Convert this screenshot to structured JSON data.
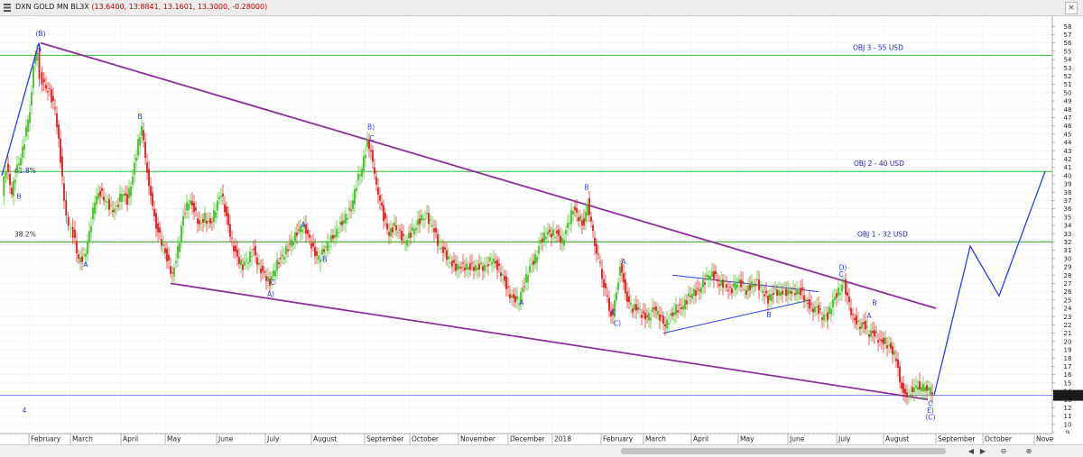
{
  "window": {
    "title": "DXN GOLD MN BL3X",
    "quote": "(13.6400, 13.8841, 13.1601, 13.3000, -0.28000)",
    "close_glyph": "×"
  },
  "scroll_buttons": [
    "◀",
    "▶",
    "⊖",
    "⊕"
  ],
  "colors": {
    "bull": "#44c026",
    "bear": "#dd1f1f",
    "trend": "#8b2e9a",
    "wave": "#2b3de0",
    "target": "#2fc12f",
    "fib": "#e05a8a",
    "current_price": "#8080ff"
  },
  "chart_data": {
    "type": "candlestick",
    "ylim": [
      9,
      59
    ],
    "xlim": [
      0,
      1145
    ],
    "y_ticks": [
      9,
      10,
      11,
      12,
      13,
      14,
      15,
      16,
      17,
      18,
      19,
      20,
      21,
      22,
      23,
      24,
      25,
      26,
      27,
      28,
      29,
      30,
      31,
      32,
      33,
      34,
      35,
      36,
      37,
      38,
      39,
      40,
      41,
      42,
      43,
      44,
      45,
      46,
      47,
      48,
      49,
      50,
      51,
      52,
      53,
      54,
      55,
      56,
      57,
      58
    ],
    "x_ticks": [
      {
        "label": "February",
        "x": 32
      },
      {
        "label": "March",
        "x": 78
      },
      {
        "label": "April",
        "x": 134
      },
      {
        "label": "May",
        "x": 183
      },
      {
        "label": "June",
        "x": 240
      },
      {
        "label": "July",
        "x": 294
      },
      {
        "label": "August",
        "x": 345
      },
      {
        "label": "September",
        "x": 404
      },
      {
        "label": "October",
        "x": 454
      },
      {
        "label": "November",
        "x": 508
      },
      {
        "label": "December",
        "x": 563
      },
      {
        "label": "2018",
        "x": 612
      },
      {
        "label": "February",
        "x": 666
      },
      {
        "label": "March",
        "x": 713
      },
      {
        "label": "April",
        "x": 766
      },
      {
        "label": "May",
        "x": 818
      },
      {
        "label": "June",
        "x": 873
      },
      {
        "label": "July",
        "x": 927
      },
      {
        "label": "August",
        "x": 979
      },
      {
        "label": "September",
        "x": 1037
      },
      {
        "label": "October",
        "x": 1089
      },
      {
        "label": "Nove",
        "x": 1146
      }
    ],
    "price_path": [
      [
        3,
        38
      ],
      [
        8,
        41
      ],
      [
        14,
        38
      ],
      [
        20,
        41
      ],
      [
        26,
        43
      ],
      [
        34,
        48
      ],
      [
        38,
        53
      ],
      [
        42,
        55
      ],
      [
        45,
        52
      ],
      [
        50,
        51
      ],
      [
        56,
        50
      ],
      [
        62,
        48
      ],
      [
        68,
        42
      ],
      [
        72,
        37
      ],
      [
        77,
        34
      ],
      [
        82,
        33
      ],
      [
        88,
        30
      ],
      [
        94,
        30
      ],
      [
        100,
        33
      ],
      [
        106,
        37
      ],
      [
        112,
        38
      ],
      [
        118,
        37
      ],
      [
        124,
        36
      ],
      [
        130,
        36
      ],
      [
        136,
        38
      ],
      [
        142,
        37
      ],
      [
        148,
        40
      ],
      [
        154,
        44
      ],
      [
        158,
        46
      ],
      [
        162,
        42
      ],
      [
        166,
        39
      ],
      [
        170,
        36
      ],
      [
        174,
        34
      ],
      [
        180,
        32
      ],
      [
        186,
        30
      ],
      [
        192,
        28
      ],
      [
        198,
        31
      ],
      [
        204,
        35
      ],
      [
        210,
        37
      ],
      [
        216,
        36
      ],
      [
        222,
        34
      ],
      [
        228,
        35
      ],
      [
        234,
        34
      ],
      [
        240,
        36
      ],
      [
        246,
        38
      ],
      [
        252,
        35
      ],
      [
        258,
        32
      ],
      [
        264,
        30
      ],
      [
        270,
        29
      ],
      [
        276,
        30
      ],
      [
        282,
        31
      ],
      [
        288,
        29
      ],
      [
        294,
        28
      ],
      [
        300,
        27
      ],
      [
        306,
        29
      ],
      [
        312,
        30
      ],
      [
        318,
        31
      ],
      [
        324,
        32
      ],
      [
        330,
        33
      ],
      [
        336,
        34
      ],
      [
        342,
        33
      ],
      [
        348,
        31
      ],
      [
        354,
        30
      ],
      [
        360,
        31
      ],
      [
        366,
        32
      ],
      [
        372,
        33
      ],
      [
        378,
        34
      ],
      [
        384,
        35
      ],
      [
        390,
        36
      ],
      [
        396,
        39
      ],
      [
        402,
        41
      ],
      [
        408,
        44
      ],
      [
        412,
        43
      ],
      [
        416,
        40
      ],
      [
        420,
        38
      ],
      [
        426,
        35
      ],
      [
        432,
        33
      ],
      [
        438,
        34
      ],
      [
        444,
        33
      ],
      [
        450,
        32
      ],
      [
        456,
        33
      ],
      [
        462,
        34
      ],
      [
        468,
        35
      ],
      [
        474,
        35
      ],
      [
        480,
        34
      ],
      [
        486,
        32
      ],
      [
        492,
        31
      ],
      [
        498,
        30
      ],
      [
        504,
        29
      ],
      [
        510,
        29
      ],
      [
        516,
        29
      ],
      [
        522,
        29
      ],
      [
        528,
        29
      ],
      [
        534,
        29
      ],
      [
        540,
        29
      ],
      [
        546,
        30
      ],
      [
        552,
        29
      ],
      [
        558,
        28
      ],
      [
        564,
        26
      ],
      [
        570,
        25
      ],
      [
        576,
        25
      ],
      [
        582,
        27
      ],
      [
        588,
        29
      ],
      [
        594,
        30
      ],
      [
        600,
        32
      ],
      [
        606,
        33
      ],
      [
        612,
        33
      ],
      [
        618,
        33
      ],
      [
        624,
        32
      ],
      [
        630,
        34
      ],
      [
        636,
        36
      ],
      [
        642,
        35
      ],
      [
        648,
        34
      ],
      [
        652,
        37
      ],
      [
        656,
        34
      ],
      [
        660,
        32
      ],
      [
        664,
        30
      ],
      [
        668,
        28
      ],
      [
        672,
        26
      ],
      [
        676,
        24
      ],
      [
        680,
        23
      ],
      [
        684,
        26
      ],
      [
        688,
        29
      ],
      [
        692,
        27
      ],
      [
        696,
        25
      ],
      [
        702,
        24
      ],
      [
        708,
        24
      ],
      [
        714,
        23
      ],
      [
        720,
        23
      ],
      [
        726,
        24
      ],
      [
        732,
        23
      ],
      [
        738,
        22
      ],
      [
        744,
        23
      ],
      [
        750,
        24
      ],
      [
        756,
        24
      ],
      [
        762,
        25
      ],
      [
        768,
        26
      ],
      [
        774,
        26
      ],
      [
        780,
        27
      ],
      [
        786,
        28
      ],
      [
        792,
        28
      ],
      [
        798,
        27
      ],
      [
        804,
        27
      ],
      [
        810,
        26
      ],
      [
        816,
        27
      ],
      [
        822,
        27
      ],
      [
        828,
        26
      ],
      [
        834,
        27
      ],
      [
        840,
        27
      ],
      [
        846,
        26
      ],
      [
        852,
        25
      ],
      [
        858,
        26
      ],
      [
        864,
        26
      ],
      [
        870,
        26
      ],
      [
        876,
        26
      ],
      [
        882,
        26
      ],
      [
        888,
        26
      ],
      [
        894,
        25
      ],
      [
        900,
        24
      ],
      [
        906,
        24
      ],
      [
        912,
        23
      ],
      [
        918,
        23
      ],
      [
        924,
        25
      ],
      [
        930,
        26
      ],
      [
        936,
        27
      ],
      [
        940,
        25
      ],
      [
        946,
        23
      ],
      [
        952,
        22
      ],
      [
        958,
        22
      ],
      [
        964,
        21
      ],
      [
        970,
        21
      ],
      [
        976,
        20
      ],
      [
        982,
        20
      ],
      [
        988,
        19
      ],
      [
        994,
        18
      ],
      [
        998,
        15
      ],
      [
        1002,
        14
      ],
      [
        1006,
        13
      ],
      [
        1010,
        14
      ],
      [
        1014,
        14
      ],
      [
        1018,
        15
      ],
      [
        1022,
        14
      ],
      [
        1026,
        15
      ],
      [
        1030,
        14
      ],
      [
        1034,
        14
      ]
    ],
    "trend_lines": [
      {
        "name": "upper-channel",
        "points": [
          [
            45,
            56
          ],
          [
            1037,
            24
          ]
        ]
      },
      {
        "name": "lower-channel",
        "points": [
          [
            189,
            27
          ],
          [
            1028,
            13
          ]
        ]
      },
      {
        "name": "triangle-top",
        "points": [
          [
            745,
            28
          ],
          [
            907,
            26
          ]
        ]
      },
      {
        "name": "triangle-bottom",
        "points": [
          [
            735,
            21
          ],
          [
            898,
            25
          ]
        ]
      }
    ],
    "wave_path": [
      [
        2,
        40
      ],
      [
        43,
        56
      ],
      [
        45,
        55
      ]
    ],
    "projection_path": [
      [
        1035,
        13.5
      ],
      [
        1075,
        31.5
      ],
      [
        1107,
        25.5
      ],
      [
        1158,
        40.5
      ]
    ],
    "horizontal_lines": [
      {
        "y": 54.5,
        "kind": "target",
        "label": "OBJ 3 - 55 USD",
        "label_x": 945
      },
      {
        "y": 40.5,
        "kind": "target",
        "label": "OBJ 2 - 40 USD",
        "label_x": 946
      },
      {
        "y": 32,
        "kind": "fib",
        "label": "38.2%",
        "label_x": 16
      },
      {
        "y": 32,
        "kind": "target",
        "label": "OBJ 1 - 32 USD",
        "label_x": 950
      },
      {
        "y": 13.5,
        "kind": "current_price",
        "label": "",
        "label_x": 0
      }
    ],
    "fib_labels": [
      {
        "text": "61.8%",
        "x": 16,
        "y": 40.5
      }
    ],
    "current_price_value": "13.3000",
    "wave_labels": [
      {
        "text": "(B)",
        "x": 45,
        "y": 56.8
      },
      {
        "text": "B",
        "x": 21,
        "y": 37.2
      },
      {
        "text": "B",
        "x": 155,
        "y": 46.8
      },
      {
        "text": "A",
        "x": 95,
        "y": 29
      },
      {
        "text": "A",
        "x": 336,
        "y": 33.8
      },
      {
        "text": "B",
        "x": 360,
        "y": 29.6
      },
      {
        "text": "C",
        "x": 302,
        "y": 26.8
      },
      {
        "text": "A)",
        "x": 300,
        "y": 25.4
      },
      {
        "text": "B)",
        "x": 411,
        "y": 45.6
      },
      {
        "text": "C",
        "x": 412,
        "y": 44.2
      },
      {
        "text": "B",
        "x": 650,
        "y": 38.3
      },
      {
        "text": "A",
        "x": 578,
        "y": 24.4
      },
      {
        "text": "A",
        "x": 691,
        "y": 29.3
      },
      {
        "text": "C",
        "x": 680,
        "y": 23.2
      },
      {
        "text": "C)",
        "x": 684,
        "y": 21.9
      },
      {
        "text": "B",
        "x": 852,
        "y": 22.9
      },
      {
        "text": "D)",
        "x": 934,
        "y": 28.6
      },
      {
        "text": "C",
        "x": 932,
        "y": 27.8
      },
      {
        "text": "B",
        "x": 969,
        "y": 24.4
      },
      {
        "text": "A",
        "x": 963,
        "y": 22.8
      },
      {
        "text": "C",
        "x": 1031,
        "y": 12.2
      },
      {
        "text": "E)",
        "x": 1031,
        "y": 11.4
      },
      {
        "text": "(C)",
        "x": 1031,
        "y": 10.6
      },
      {
        "text": "4",
        "x": 27,
        "y": 11.4
      }
    ]
  }
}
